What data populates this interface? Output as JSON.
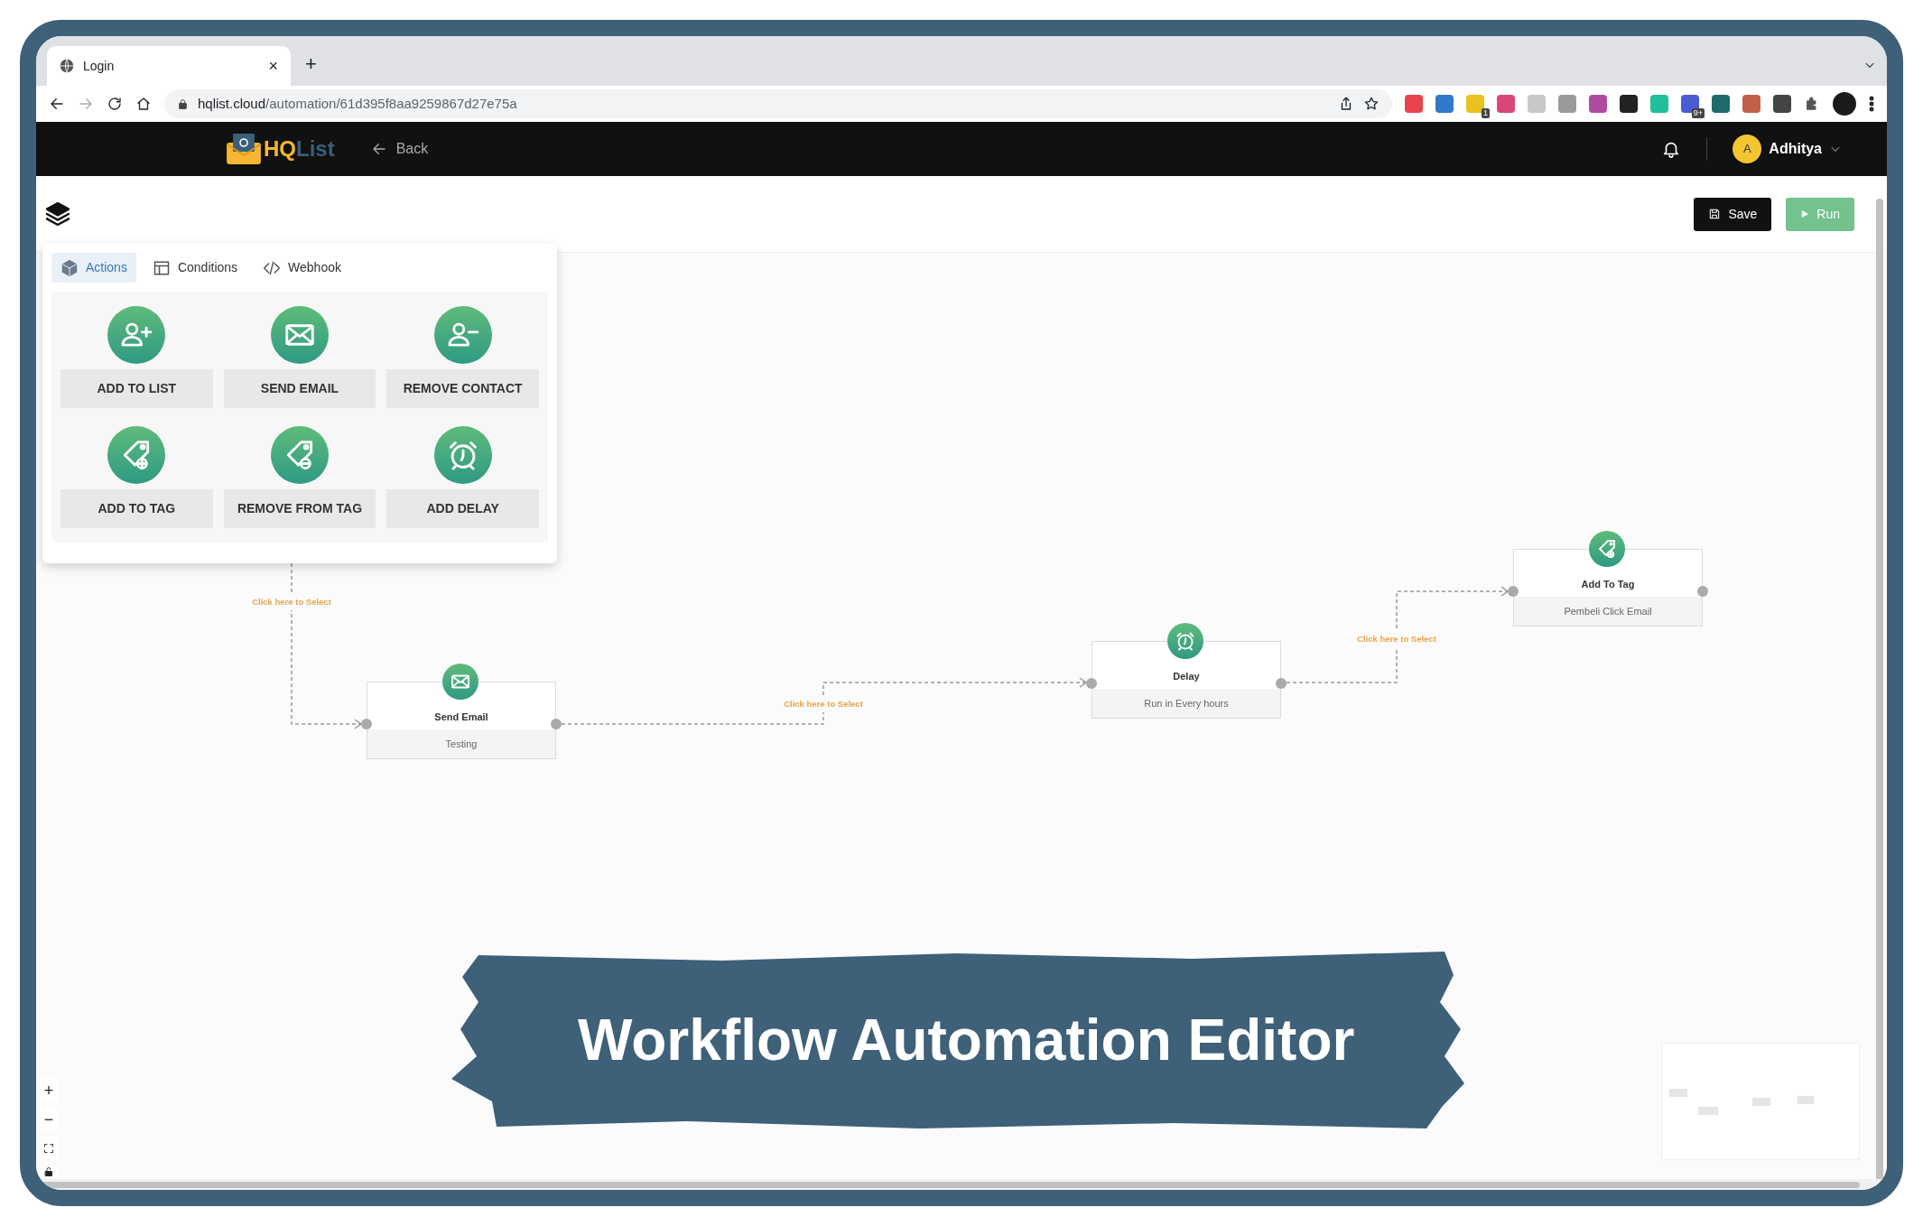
{
  "browser": {
    "tab": {
      "title": "Login",
      "close": "×"
    },
    "new_tab": "+",
    "address": {
      "host": "hqlist.cloud",
      "path": "/automation/61d395f8aa9259867d27e75a"
    },
    "extensions": [
      {
        "color": "#e9434d"
      },
      {
        "color": "#2f79c9"
      },
      {
        "color": "#e8c21e",
        "badge": "1"
      },
      {
        "color": "#d9477a"
      },
      {
        "color": "#c8c8c8"
      },
      {
        "color": "#9a9a9a"
      },
      {
        "color": "#b04aa0"
      },
      {
        "color": "#222222"
      },
      {
        "color": "#1fbf9a"
      },
      {
        "color": "#4a5bd6",
        "badge": "9+"
      },
      {
        "color": "#1f6a6a"
      },
      {
        "color": "#c0604a"
      },
      {
        "color": "#444444"
      }
    ]
  },
  "app": {
    "logo": {
      "part_1": "HQ",
      "part_2": "List"
    },
    "back": "Back",
    "user": {
      "initial": "A",
      "name": "Adhitya"
    }
  },
  "toolbar": {
    "save": "Save",
    "run": "Run"
  },
  "panel": {
    "tabs": [
      {
        "label": "Actions",
        "kind": "cube",
        "selected": true
      },
      {
        "label": "Conditions",
        "kind": "table",
        "selected": false
      },
      {
        "label": "Webhook",
        "kind": "code",
        "selected": false
      }
    ],
    "actions": [
      {
        "label": "ADD TO LIST",
        "kind": "add-person"
      },
      {
        "label": "SEND EMAIL",
        "kind": "mail"
      },
      {
        "label": "REMOVE CONTACT",
        "kind": "remove-person"
      },
      {
        "label": "ADD TO TAG",
        "kind": "tag-add"
      },
      {
        "label": "REMOVE FROM TAG",
        "kind": "tag-remove"
      },
      {
        "label": "ADD DELAY",
        "kind": "alarm"
      }
    ]
  },
  "nodes": [
    {
      "title": "Send Email",
      "subtitle": "Testing",
      "kind": "mail"
    },
    {
      "title": "Delay",
      "subtitle": "Run in Every hours",
      "kind": "alarm"
    },
    {
      "title": "Add To Tag",
      "subtitle": "Pembeli Click Email",
      "kind": "tag-add"
    }
  ],
  "connectors": [
    {
      "label": "Click here to Select"
    },
    {
      "label": "Click here to Select"
    },
    {
      "label": "Click here to Select"
    }
  ],
  "zoom_controls": {
    "zoom_in": "+",
    "zoom_out": "−"
  },
  "banner": {
    "title": "Workflow Automation Editor"
  }
}
